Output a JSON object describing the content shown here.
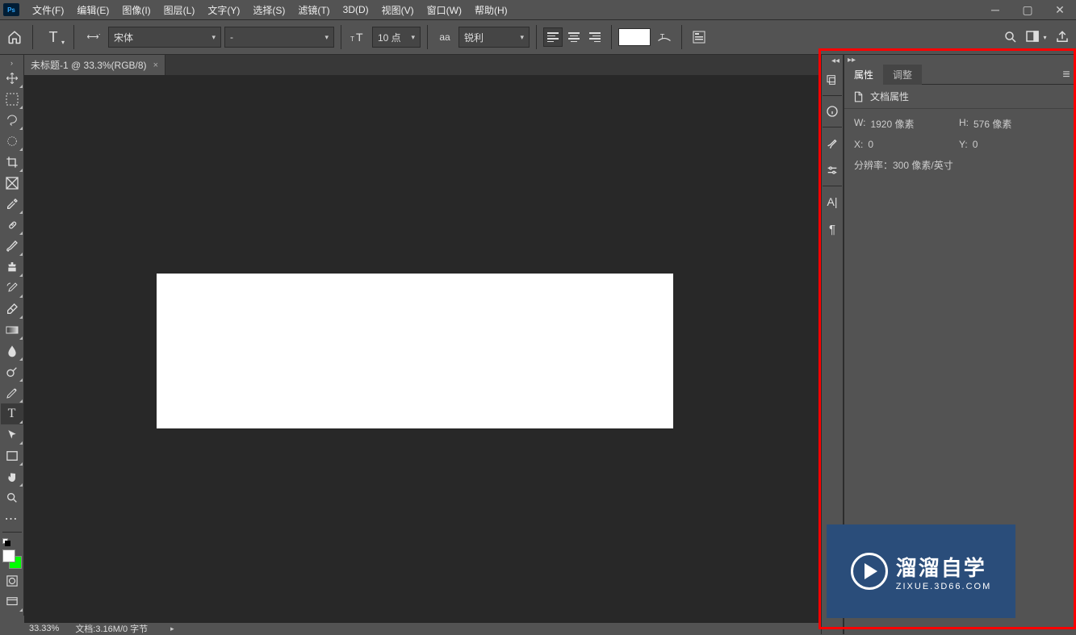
{
  "app": {
    "icon": "Ps"
  },
  "menu": [
    "文件(F)",
    "编辑(E)",
    "图像(I)",
    "图层(L)",
    "文字(Y)",
    "选择(S)",
    "滤镜(T)",
    "3D(D)",
    "视图(V)",
    "窗口(W)",
    "帮助(H)"
  ],
  "options": {
    "font_family": "宋体",
    "font_style": "-",
    "size": "10 点",
    "aa_label": "aa",
    "aa_mode": "锐利"
  },
  "doc_tab": {
    "title": "未标题-1 @ 33.3%(RGB/8)"
  },
  "status": {
    "zoom": "33.33%",
    "doc_info": "文档:3.16M/0 字节"
  },
  "panel": {
    "tab_props": "属性",
    "tab_adjust": "调整",
    "header": "文档属性",
    "w_label": "W:",
    "w_val": "1920 像素",
    "h_label": "H:",
    "h_val": "576 像素",
    "x_label": "X:",
    "x_val": "0",
    "y_label": "Y:",
    "y_val": "0",
    "res": "分辨率：300 像素/英寸"
  },
  "watermark": {
    "big": "溜溜自学",
    "small": "ZIXUE.3D66.COM"
  },
  "colors": {
    "accent": "#ff0000",
    "fg": "#ffffff",
    "bg_swap": "#00ff00",
    "panel_bg": "#535353"
  }
}
